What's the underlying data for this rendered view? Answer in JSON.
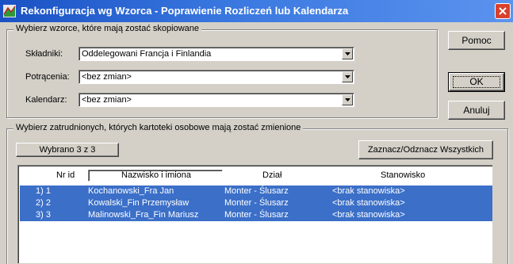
{
  "window": {
    "title": "Rekonfiguracja wg Wzorca - Poprawienie Rozliczeń lub Kalendarza"
  },
  "patterns": {
    "group_label": "Wybierz wzorce, które mają zostać skopiowane",
    "fields": [
      {
        "label": "Składniki:",
        "value": "Oddelegowani Francja i Finlandia"
      },
      {
        "label": "Potrącenia:",
        "value": "<bez zmian>"
      },
      {
        "label": "Kalendarz:",
        "value": "<bez zmian>"
      }
    ]
  },
  "buttons": {
    "help": "Pomoc",
    "ok": "OK",
    "cancel": "Anuluj"
  },
  "employees": {
    "group_label": "Wybierz zatrudnionych, których kartoteki osobowe mają zostać zmienione",
    "selected_count": "Wybrano 3 z 3",
    "toggle_all": "Zaznacz/Odznacz Wszystkich",
    "columns": [
      "Nr id",
      "Nazwisko i imiona",
      "Dział",
      "Stanowisko"
    ],
    "rows": [
      {
        "no": "1) 1",
        "name": "Kochanowski_Fra Jan",
        "dept": "Monter - Ślusarz",
        "position": "<brak stanowiska>"
      },
      {
        "no": "2) 2",
        "name": "Kowalski_Fin Przemysław",
        "dept": "Monter - Ślusarz",
        "position": "<brak stanowiska>"
      },
      {
        "no": "3) 3",
        "name": "Malinowski_Fra_Fin Mariusz",
        "dept": "Monter - Ślusarz",
        "position": "<brak stanowiska>"
      }
    ]
  },
  "colors": {
    "title_bar": "#1a51c4",
    "selection": "#3b6fc8",
    "dialog_bg": "#d4d0c8"
  }
}
